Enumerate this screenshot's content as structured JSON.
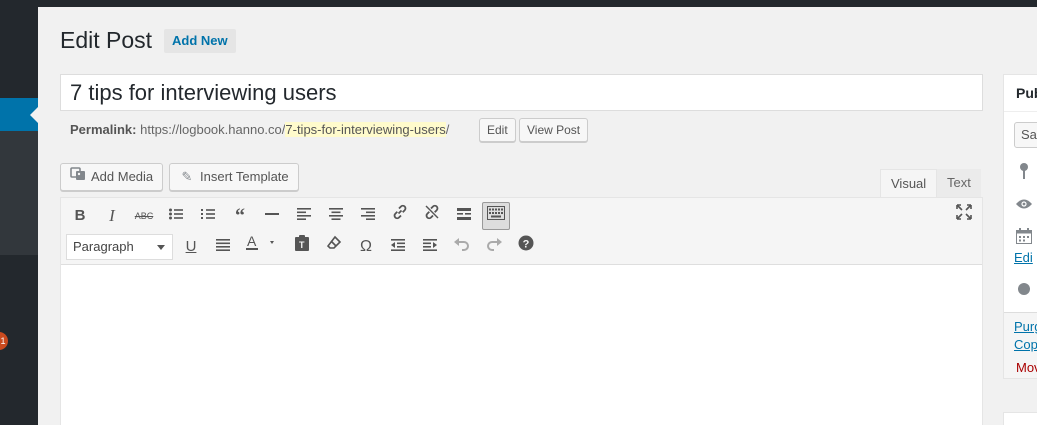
{
  "header": {
    "title": "Edit Post",
    "add_new_label": "Add New"
  },
  "post": {
    "title": "7 tips for interviewing users"
  },
  "permalink": {
    "label": "Permalink:",
    "base_url": "https://logbook.hanno.co/",
    "slug": "7-tips-for-interviewing-users",
    "trailing": "/",
    "edit_label": "Edit",
    "view_label": "View Post"
  },
  "media_buttons": {
    "add_media": "Add Media",
    "insert_template": "Insert Template"
  },
  "editor_tabs": {
    "visual": "Visual",
    "text": "Text"
  },
  "toolbar": {
    "format_select_value": "Paragraph",
    "row1_icons": [
      "bold-icon",
      "italic-icon",
      "strikethrough-icon",
      "bullet-list-icon",
      "numbered-list-icon",
      "blockquote-icon",
      "horizontal-line-icon",
      "align-left-icon",
      "align-center-icon",
      "align-right-icon",
      "link-icon",
      "unlink-icon",
      "read-more-icon",
      "toolbar-toggle-icon"
    ],
    "row2_icons": [
      "underline-icon",
      "justify-icon",
      "text-color-icon",
      "paste-as-text-icon",
      "clear-formatting-icon",
      "special-character-icon",
      "outdent-icon",
      "indent-icon",
      "undo-icon",
      "redo-icon",
      "help-icon"
    ],
    "fullscreen_icon": "fullscreen-icon"
  },
  "publish_box": {
    "title": "Pub",
    "save_draft": "Sa",
    "edit_link": "Edi",
    "purge_line1": "Purg",
    "purge_line2": "Cop",
    "move_to_trash": "Mov"
  },
  "sidebar": {
    "update_count": "1"
  },
  "colors": {
    "admin_dark": "#23282d",
    "admin_blue": "#0073aa",
    "slug_highlight": "#fffbcc",
    "trash_red": "#a00"
  }
}
